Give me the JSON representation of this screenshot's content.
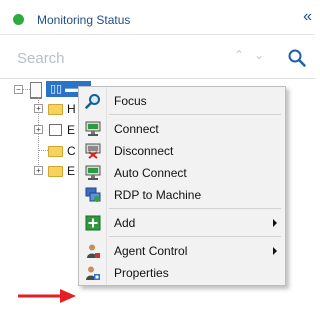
{
  "header": {
    "title": "Monitoring Status",
    "status_color": "#2eaa3f",
    "collapse_icon": "«"
  },
  "search": {
    "placeholder": "Search",
    "nav_up": "⌃",
    "nav_down": "⌄"
  },
  "tree": {
    "root_label": "▯▯ ▬▬",
    "children": [
      {
        "label": "H",
        "icon": "folder-icon"
      },
      {
        "label": "E",
        "icon": "calendar-icon"
      },
      {
        "label": "C",
        "icon": "folder-icon"
      },
      {
        "label": "E",
        "icon": "folder-icon"
      }
    ]
  },
  "context_menu": {
    "items": [
      {
        "label": "Focus",
        "icon": "magnifier-icon"
      },
      {
        "label": "Connect",
        "icon": "monitor-connect-icon"
      },
      {
        "label": "Disconnect",
        "icon": "monitor-disconnect-icon"
      },
      {
        "label": "Auto Connect",
        "icon": "monitor-auto-icon"
      },
      {
        "label": "RDP to Machine",
        "icon": "rdp-icon"
      },
      {
        "label": "Add",
        "icon": "add-icon",
        "submenu": true
      },
      {
        "label": "Agent Control",
        "icon": "agent-icon",
        "submenu": true
      },
      {
        "label": "Properties",
        "icon": "properties-icon"
      }
    ]
  },
  "annotation": {
    "arrow_color": "#e52020"
  }
}
